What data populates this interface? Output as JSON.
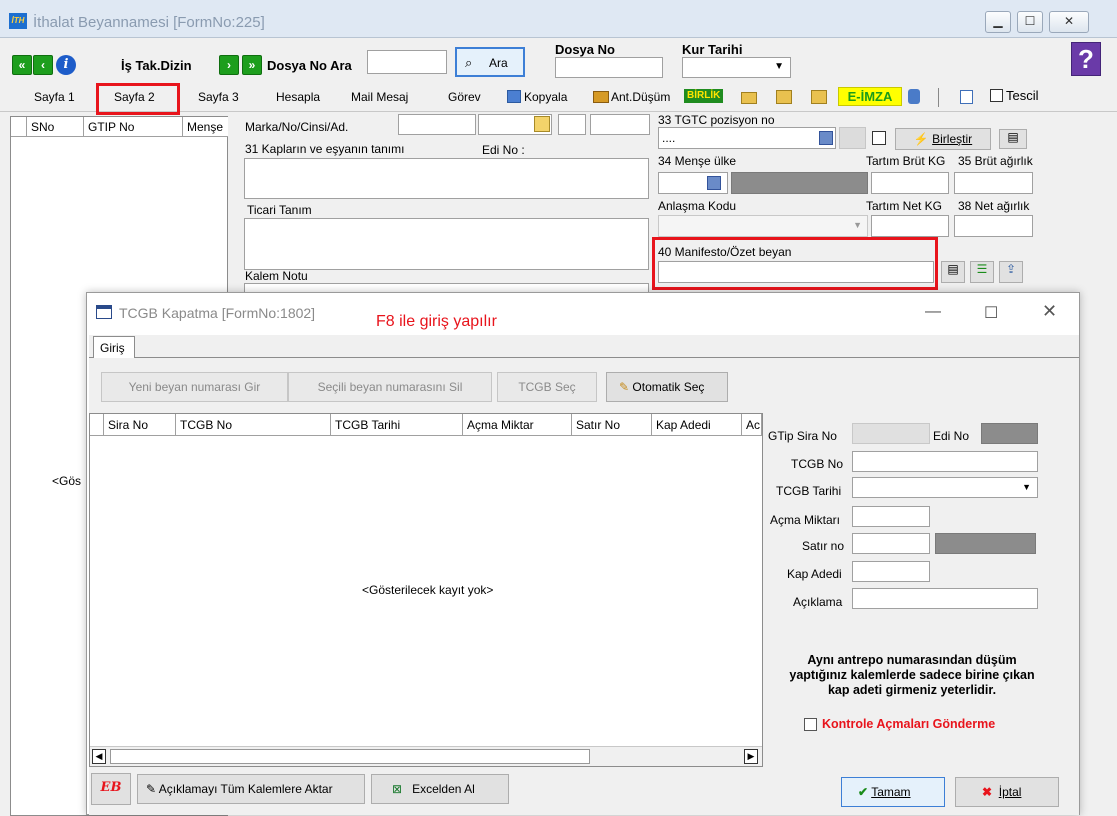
{
  "window": {
    "title": "İthalat Beyannamesi [FormNo:225]",
    "logo": "İTH"
  },
  "toolbar": {
    "is_takip": "İş Tak.Dizin",
    "dosya_ara": "Dosya No Ara",
    "ara": "Ara",
    "dosya_no": "Dosya No",
    "kur_tarihi": "Kur Tarihi"
  },
  "tabs": [
    "Sayfa 1",
    "Sayfa 2",
    "Sayfa 3",
    "Hesapla",
    "Mail Mesaj",
    "Görev",
    "Kopyala",
    "Ant.Düşüm",
    "BİRLİK",
    "E-İMZA",
    "Tescil"
  ],
  "grid": {
    "columns": [
      "SNo",
      "GTIP No",
      "Menşe"
    ],
    "empty": "<Gös"
  },
  "form": {
    "marka": "Marka/No/Cinsi/Ad.",
    "kaplar": "31 Kapların ve eşyanın tanımı",
    "edi_no": "Edi No :",
    "ticari": "Ticari Tanım",
    "kalem_notu": "Kalem Notu",
    "gtc": "33 TGTC pozisyon no",
    "gtc_value": "....",
    "birlestir": "Birleştir",
    "mense": "34 Menşe ülke",
    "brut_kg": "Tartım Brüt KG",
    "brut_agirlik": "35 Brüt ağırlık",
    "anlasma": "Anlaşma Kodu",
    "net_kg": "Tartım Net KG",
    "net_agirlik": "38 Net ağırlık",
    "manifesto": "40 Manifesto/Özet beyan"
  },
  "dialog": {
    "title": "TCGB Kapatma [FormNo:1802]",
    "annotation": "F8 ile giriş yapılır",
    "tab": "Giriş",
    "buttons": {
      "yeni": "Yeni beyan numarası Gir",
      "sil": "Seçili beyan numarasını Sil",
      "tcgb_sec": "TCGB Seç",
      "otomatik": "Otomatik Seç"
    },
    "columns": [
      "Sira No",
      "TCGB No",
      "TCGB Tarihi",
      "Açma Miktar",
      "Satır No",
      "Kap Adedi",
      "Ac"
    ],
    "empty": "<Gösterilecek kayıt yok>",
    "fields": {
      "gtip_sira": "GTip Sira No",
      "edi_no": "Edi No",
      "tcgb_no": "TCGB No",
      "tcgb_tarihi": "TCGB Tarihi",
      "acma": "Açma Miktarı",
      "satir": "Satır no",
      "kap": "Kap Adedi",
      "aciklama": "Açıklama"
    },
    "note": "Aynı antrepo numarasından düşüm yaptığınız kalemlerde sadece birine çıkan kap adeti girmeniz yeterlidir.",
    "checkbox": "Kontrole Açmaları Gönderme",
    "aktar": "Açıklamayı Tüm Kalemlere Aktar",
    "excel": "Excelden Al",
    "tamam": "Tamam",
    "iptal": "İptal",
    "eb": "EB"
  }
}
